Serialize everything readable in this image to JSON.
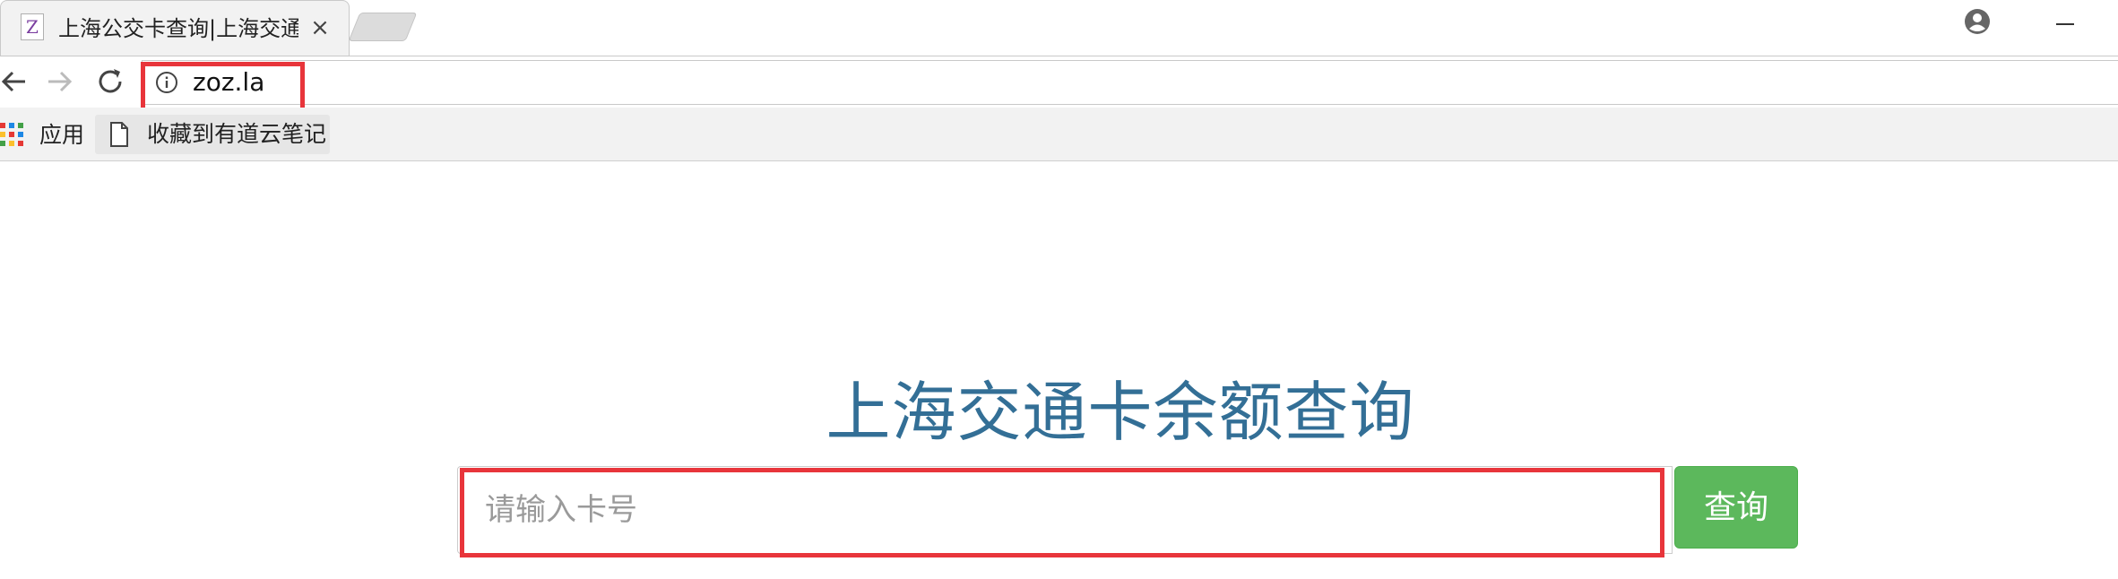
{
  "browser": {
    "tab": {
      "favicon_letter": "Z",
      "title": "上海公交卡查询|上海交通卡余额查询",
      "close_glyph": "×"
    },
    "address_bar": {
      "url": "zoz.la"
    },
    "bookmarks": {
      "apps_label": "应用",
      "items": [
        {
          "label": "收藏到有道云笔记"
        }
      ]
    }
  },
  "page": {
    "title": "上海交通卡余额查询",
    "search": {
      "placeholder": "请输入卡号",
      "value": "",
      "button_label": "查询"
    }
  },
  "colors": {
    "highlight": "#e8353b",
    "title": "#336f96",
    "button": "#5cb85c"
  },
  "icons": [
    "back-icon",
    "forward-icon",
    "reload-icon",
    "info-icon",
    "apps-grid-icon",
    "file-icon",
    "profile-icon",
    "minimize-icon",
    "close-icon"
  ]
}
